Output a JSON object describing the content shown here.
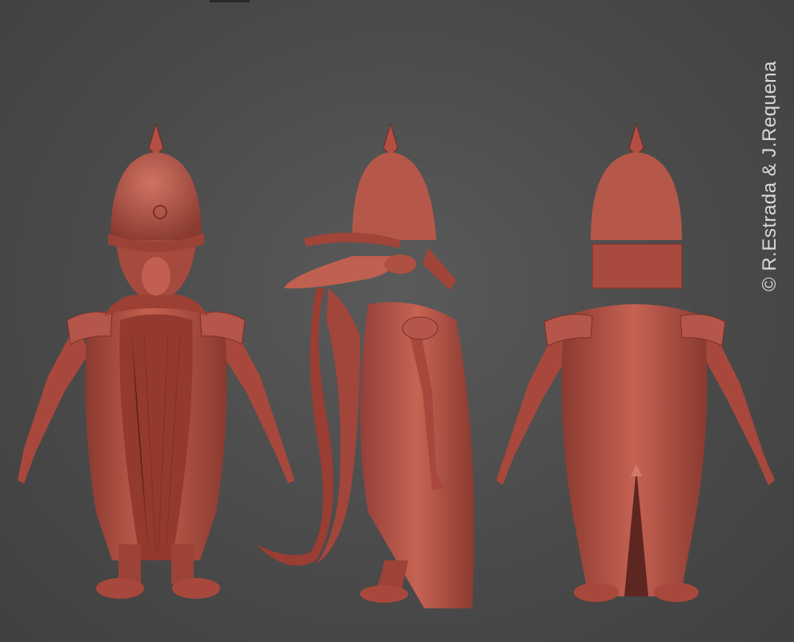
{
  "image": {
    "background_color": "#4d4d4d",
    "clay_color": "#b8554a",
    "clay_shadow": "#7e3129",
    "clay_highlight": "#d27868"
  },
  "views": [
    {
      "name": "front"
    },
    {
      "name": "side"
    },
    {
      "name": "back"
    }
  ],
  "watermark": {
    "text": "© R.Estrada & J.Requena"
  }
}
